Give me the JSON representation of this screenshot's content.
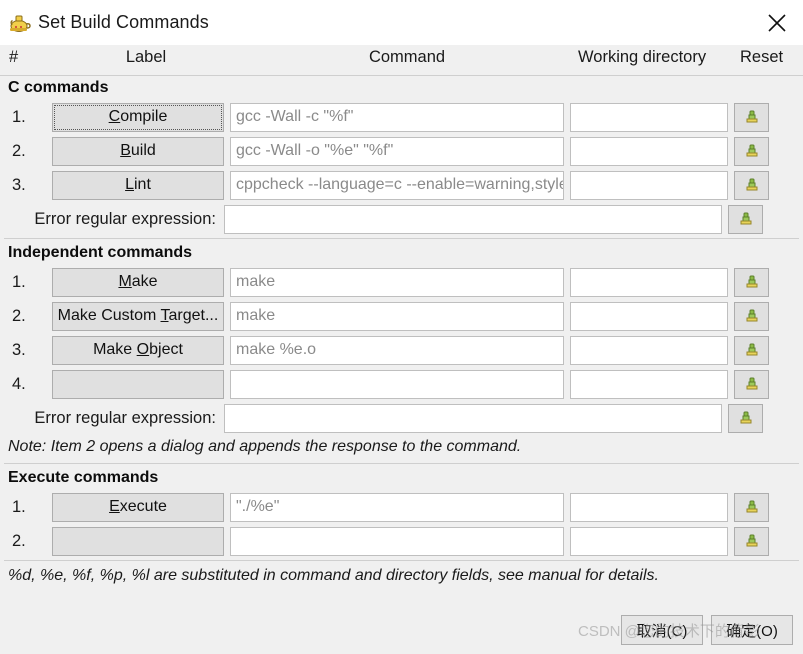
{
  "window": {
    "title": "Set Build Commands",
    "app_icon": "geany-lamp-icon",
    "close_label": "✕"
  },
  "columns": {
    "number": "#",
    "label": "Label",
    "command": "Command",
    "working_directory": "Working directory",
    "reset": "Reset"
  },
  "sections": [
    {
      "id": "c-commands",
      "title": "C commands",
      "rows": [
        {
          "num": "1.",
          "label": "Compile",
          "mnemonic": "C",
          "command": "gcc -Wall -c \"%f\"",
          "workdir": "",
          "focused": true
        },
        {
          "num": "2.",
          "label": "Build",
          "mnemonic": "B",
          "command": "gcc -Wall -o \"%e\" \"%f\"",
          "workdir": "",
          "focused": false
        },
        {
          "num": "3.",
          "label": "Lint",
          "mnemonic": "L",
          "command": "cppcheck --language=c --enable=warning,style,performance,portability \"%f\"",
          "workdir": "",
          "focused": false
        }
      ],
      "error_regex_label": "Error regular expression:",
      "error_regex_value": ""
    },
    {
      "id": "independent-commands",
      "title": "Independent commands",
      "rows": [
        {
          "num": "1.",
          "label": "Make",
          "mnemonic": "M",
          "command": "make",
          "workdir": "",
          "focused": false
        },
        {
          "num": "2.",
          "label": "Make Custom Target...",
          "mnemonic": "T",
          "command": "make",
          "workdir": "",
          "focused": false
        },
        {
          "num": "3.",
          "label": "Make Object",
          "mnemonic": "O",
          "command": "make %e.o",
          "workdir": "",
          "focused": false
        },
        {
          "num": "4.",
          "label": "",
          "mnemonic": "",
          "command": "",
          "workdir": "",
          "focused": false
        }
      ],
      "error_regex_label": "Error regular expression:",
      "error_regex_value": "",
      "note": "Note: Item 2 opens a dialog and appends the response to the command."
    },
    {
      "id": "execute-commands",
      "title": "Execute commands",
      "rows": [
        {
          "num": "1.",
          "label": "Execute",
          "mnemonic": "E",
          "command": "\"./%e\"",
          "workdir": "",
          "focused": false
        },
        {
          "num": "2.",
          "label": "",
          "mnemonic": "",
          "command": "",
          "workdir": "",
          "focused": false
        }
      ]
    }
  ],
  "footnote": "%d, %e, %f, %p, %l are substituted in command and directory fields, see manual for details.",
  "footer": {
    "cancel_label": "取消(C)",
    "ok_label": "确定(O)"
  },
  "watermark": "CSDN @您的技术下的背影",
  "colors": {
    "dialog_bg": "#f0f0f0",
    "titlebar_bg": "#ffffff",
    "button_bg": "#e0e0e0",
    "button_border": "#adadad",
    "field_bg": "#ffffff",
    "field_border": "#bfbfbf",
    "placeholder_text": "#8a8a8a",
    "text": "#1a1a1a",
    "icon_green": "#7aab3a",
    "icon_yellow": "#e8c84a"
  }
}
